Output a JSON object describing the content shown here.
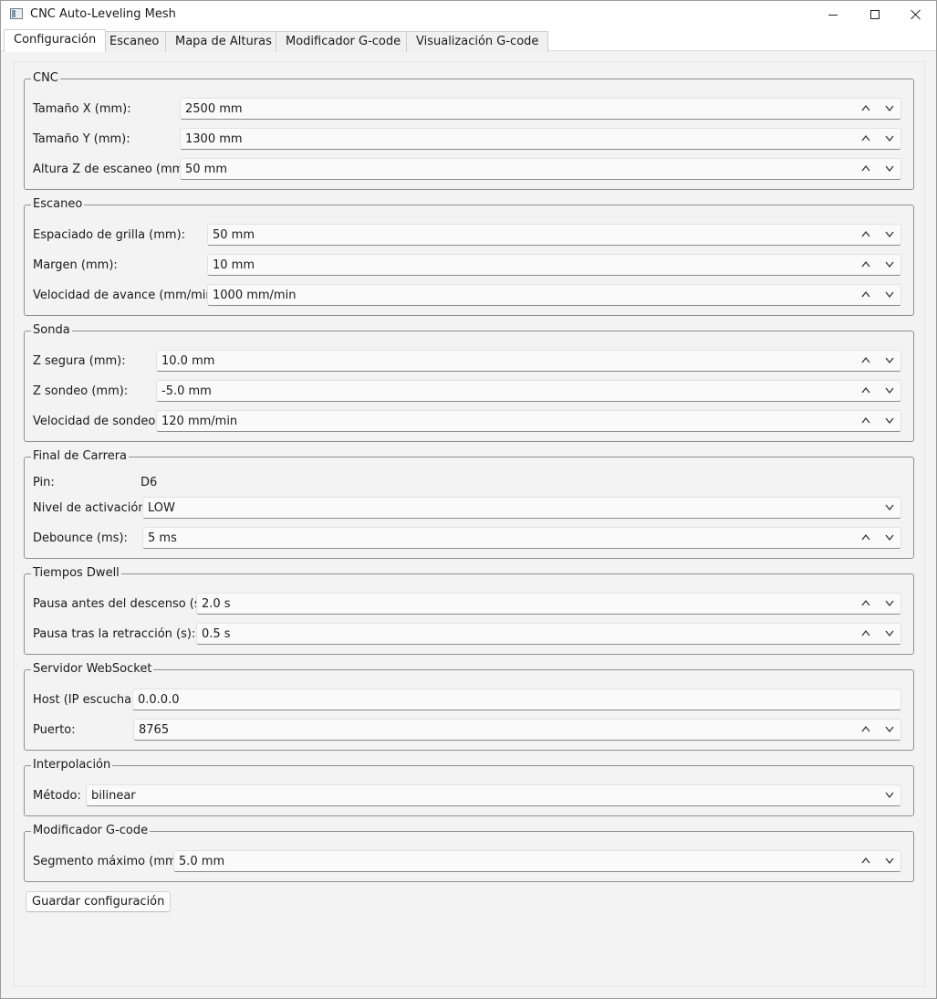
{
  "window": {
    "title": "CNC Auto-Leveling Mesh"
  },
  "tabs": [
    {
      "label": "Configuración"
    },
    {
      "label": "Escaneo"
    },
    {
      "label": "Mapa de Alturas"
    },
    {
      "label": "Modificador G-code"
    },
    {
      "label": "Visualización G-code"
    }
  ],
  "cnc": {
    "title": "CNC",
    "size_x": {
      "label": "Tamaño X (mm):",
      "value": "2500 mm"
    },
    "size_y": {
      "label": "Tamaño Y (mm):",
      "value": "1300 mm"
    },
    "scan_z": {
      "label": "Altura Z de escaneo (mm):",
      "value": "50 mm"
    }
  },
  "scan": {
    "title": "Escaneo",
    "grid": {
      "label": "Espaciado de grilla (mm):",
      "value": "50 mm"
    },
    "margin": {
      "label": "Margen (mm):",
      "value": "10 mm"
    },
    "feed": {
      "label": "Velocidad de avance (mm/min):",
      "value": "1000 mm/min"
    }
  },
  "probe": {
    "title": "Sonda",
    "safe_z": {
      "label": "Z segura (mm):",
      "value": "10.0 mm"
    },
    "probe_z": {
      "label": "Z sondeo (mm):",
      "value": "-5.0 mm"
    },
    "speed": {
      "label": "Velocidad de sondeo:",
      "value": "120 mm/min"
    }
  },
  "limit": {
    "title": "Final de Carrera",
    "pin": {
      "label": "Pin:",
      "value": "D6"
    },
    "level": {
      "label": "Nivel de activación:",
      "value": "LOW"
    },
    "debounce": {
      "label": "Debounce (ms):",
      "value": "5 ms"
    }
  },
  "dwell": {
    "title": "Tiempos Dwell",
    "before": {
      "label": "Pausa antes del descenso (s):",
      "value": "2.0 s"
    },
    "after": {
      "label": "Pausa tras la retracción (s):",
      "value": "0.5 s"
    }
  },
  "ws": {
    "title": "Servidor WebSocket",
    "host": {
      "label": "Host (IP escucha):",
      "value": "0.0.0.0"
    },
    "port": {
      "label": "Puerto:",
      "value": "8765"
    }
  },
  "interp": {
    "title": "Interpolación",
    "method": {
      "label": "Método:",
      "value": "bilinear"
    }
  },
  "gcode": {
    "title": "Modificador G-code",
    "segment": {
      "label": "Segmento máximo (mm):",
      "value": "5.0 mm"
    }
  },
  "actions": {
    "save_label": "Guardar configuración"
  }
}
